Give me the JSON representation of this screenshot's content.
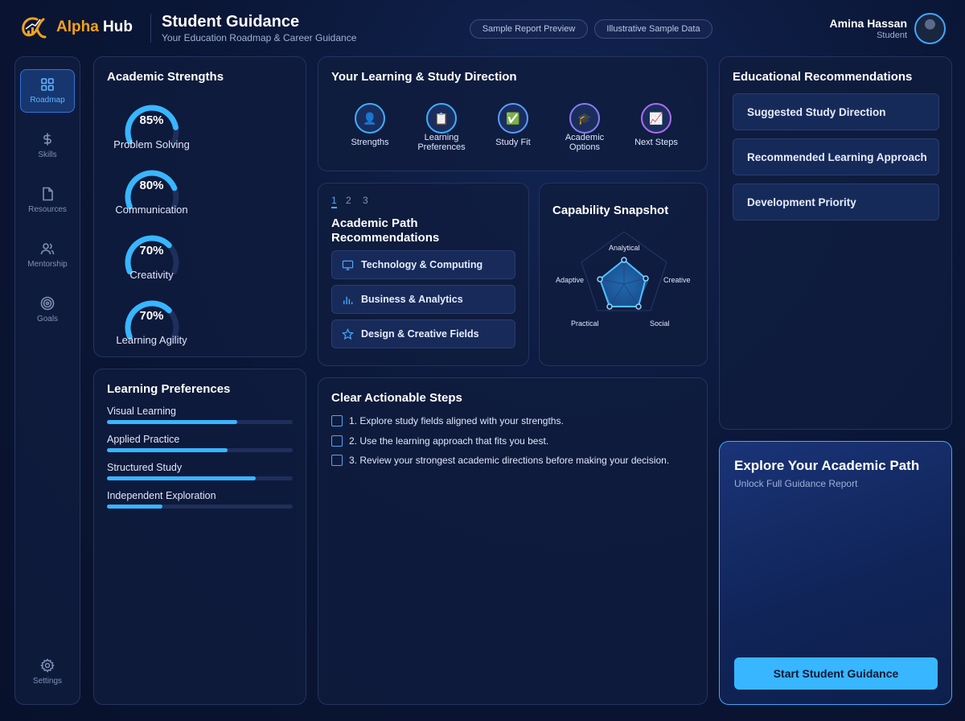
{
  "brand": {
    "name_accent": "Alpha",
    "name_rest": " Hub"
  },
  "header": {
    "title": "Student Guidance",
    "subtitle": "Your Education Roadmap & Career Guidance",
    "pills": [
      "Sample Report Preview",
      "Illustrative Sample Data"
    ]
  },
  "user": {
    "name": "Amina Hassan",
    "role": "Student"
  },
  "sidebar": {
    "items": [
      {
        "label": "Roadmap",
        "icon": "grid-icon",
        "active": true
      },
      {
        "label": "Skills",
        "icon": "dollar-icon",
        "active": false
      },
      {
        "label": "Resources",
        "icon": "document-icon",
        "active": false
      },
      {
        "label": "Mentorship",
        "icon": "people-icon",
        "active": false
      },
      {
        "label": "Goals",
        "icon": "target-icon",
        "active": false
      }
    ],
    "settings": {
      "label": "Settings",
      "icon": "gear-icon"
    }
  },
  "academic_strengths": {
    "title": "Academic Strengths",
    "items": [
      {
        "label": "Problem Solving",
        "value_text": "85%",
        "value": 85
      },
      {
        "label": "Communication",
        "value_text": "80%",
        "value": 80
      },
      {
        "label": "Creativity",
        "value_text": "70%",
        "value": 70
      },
      {
        "label": "Learning Agility",
        "value_text": "70%",
        "value": 70
      }
    ]
  },
  "learning_preferences": {
    "title": "Learning Preferences",
    "items": [
      {
        "label": "Visual Learning",
        "value": 70
      },
      {
        "label": "Applied Practice",
        "value": 65
      },
      {
        "label": "Structured Study",
        "value": 80
      },
      {
        "label": "Independent Exploration",
        "value": 30
      }
    ]
  },
  "direction": {
    "title": "Your Learning & Study Direction",
    "steps": [
      {
        "label": "Strengths",
        "icon": "person-icon",
        "emoji": "👤",
        "color": "#3fb0ff"
      },
      {
        "label": "Learning Preferences",
        "icon": "clipboard-icon",
        "emoji": "📋",
        "color": "#3fb0ff"
      },
      {
        "label": "Study Fit",
        "icon": "checkmark-icon",
        "emoji": "✅",
        "color": "#5a9cff"
      },
      {
        "label": "Academic Options",
        "icon": "graduation-cap-icon",
        "emoji": "🎓",
        "color": "#8a7cf0"
      },
      {
        "label": "Next Steps",
        "icon": "chart-icon",
        "emoji": "📈",
        "color": "#b06cf0"
      }
    ]
  },
  "academic_path": {
    "tabs": [
      "1",
      "2",
      "3"
    ],
    "title": "Academic Path Recommendations",
    "items": [
      {
        "label": "Technology & Computing",
        "icon": "monitor-icon"
      },
      {
        "label": "Business & Analytics",
        "icon": "bar-chart-icon"
      },
      {
        "label": "Design & Creative Fields",
        "icon": "star-icon"
      }
    ]
  },
  "capability": {
    "title": "Capability Snapshot",
    "axes": [
      "Analytical",
      "Creative",
      "Social",
      "Practical",
      "Adaptive"
    ]
  },
  "steps": {
    "title": "Clear Actionable Steps",
    "items": [
      "1. Explore study fields aligned with your strengths.",
      "2. Use the learning approach that fits you best.",
      "3. Review your strongest academic directions before making your decision."
    ]
  },
  "recommendations": {
    "title": "Educational Recommendations",
    "items": [
      "Suggested Study Direction",
      "Recommended Learning Approach",
      "Development Priority"
    ]
  },
  "cta": {
    "title": "Explore Your Academic Path",
    "subtitle": "Unlock Full Guidance Report",
    "button": "Start Student Guidance"
  },
  "colors": {
    "accent": "#38b6ff",
    "brand_orange": "#f6a21b",
    "background": "#0b1738"
  }
}
